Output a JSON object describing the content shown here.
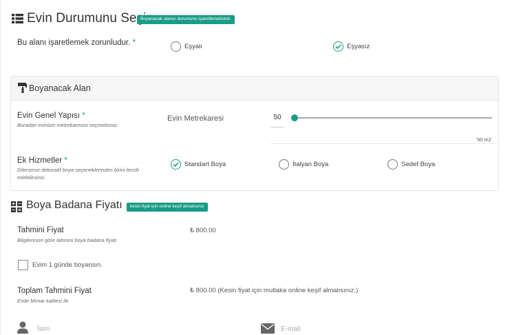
{
  "house_state": {
    "title": "Evin Durumunu Seçin",
    "badge": "Boyanacak alanın durumunu işaretlemelisiniz.",
    "question": "Bu alanı işaretlemek zorunludur.",
    "required_mark": "*",
    "options": [
      {
        "label": "Eşyalı",
        "checked": false
      },
      {
        "label": "Eşyasız",
        "checked": true
      }
    ]
  },
  "paint_area": {
    "title": "Boyanacak Alan",
    "structure_label": "Evin Genel Yapısı",
    "structure_required": "*",
    "structure_help": "Buradan evinizin metrekaresini seçmelisiniz.",
    "area_label": "Evin Metrekaresi",
    "area_value": "50",
    "slider_unit_label": "50 m2",
    "slider_level": 0,
    "extra_label": "Ek Hizmetler",
    "extra_required": "*",
    "extra_help": "Dilerseniz dekoratif boya seçeneklerinden birini tercih edebilirsiniz.",
    "extra_options": [
      {
        "label": "Standart Boya",
        "checked": true
      },
      {
        "label": "İtalyan Boya",
        "checked": false
      },
      {
        "label": "Sedef Boya",
        "checked": false
      }
    ]
  },
  "price": {
    "title": "Boya Badana Fiyatı",
    "badge": "kesin fiyat için online keşif almalısınız",
    "estimated_label": "Tahmini Fiyat",
    "estimated_help": "Bilgilerinize göre tahmini boya badana fiyatı",
    "estimated_value": "₺ 800.00",
    "one_day_label": "Evim 1 günde boyansın.",
    "total_label": "Toplam Tahmini Fiyat",
    "total_help": "Evde Mimar kalitesi ile",
    "total_value": "₺ 800.00 (Kesin fiyat için mutlaka online keşif almalısınız.)"
  },
  "contact": {
    "name_placeholder": "İsim",
    "email_placeholder": "E-mail"
  },
  "colors": {
    "accent": "#1a9b85",
    "text": "#333333"
  }
}
